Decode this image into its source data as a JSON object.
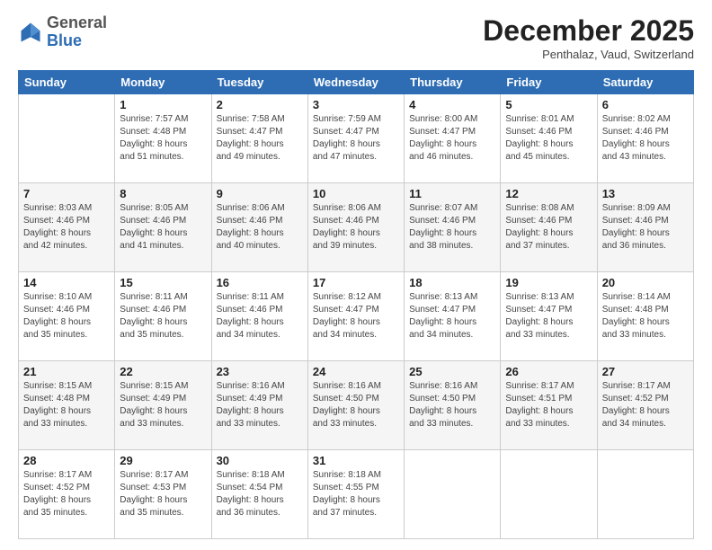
{
  "header": {
    "logo": {
      "general": "General",
      "blue": "Blue"
    },
    "title": "December 2025",
    "subtitle": "Penthalaz, Vaud, Switzerland"
  },
  "weekdays": [
    "Sunday",
    "Monday",
    "Tuesday",
    "Wednesday",
    "Thursday",
    "Friday",
    "Saturday"
  ],
  "weeks": [
    [
      {
        "day": "",
        "info": ""
      },
      {
        "day": "1",
        "info": "Sunrise: 7:57 AM\nSunset: 4:48 PM\nDaylight: 8 hours\nand 51 minutes."
      },
      {
        "day": "2",
        "info": "Sunrise: 7:58 AM\nSunset: 4:47 PM\nDaylight: 8 hours\nand 49 minutes."
      },
      {
        "day": "3",
        "info": "Sunrise: 7:59 AM\nSunset: 4:47 PM\nDaylight: 8 hours\nand 47 minutes."
      },
      {
        "day": "4",
        "info": "Sunrise: 8:00 AM\nSunset: 4:47 PM\nDaylight: 8 hours\nand 46 minutes."
      },
      {
        "day": "5",
        "info": "Sunrise: 8:01 AM\nSunset: 4:46 PM\nDaylight: 8 hours\nand 45 minutes."
      },
      {
        "day": "6",
        "info": "Sunrise: 8:02 AM\nSunset: 4:46 PM\nDaylight: 8 hours\nand 43 minutes."
      }
    ],
    [
      {
        "day": "7",
        "info": "Sunrise: 8:03 AM\nSunset: 4:46 PM\nDaylight: 8 hours\nand 42 minutes."
      },
      {
        "day": "8",
        "info": "Sunrise: 8:05 AM\nSunset: 4:46 PM\nDaylight: 8 hours\nand 41 minutes."
      },
      {
        "day": "9",
        "info": "Sunrise: 8:06 AM\nSunset: 4:46 PM\nDaylight: 8 hours\nand 40 minutes."
      },
      {
        "day": "10",
        "info": "Sunrise: 8:06 AM\nSunset: 4:46 PM\nDaylight: 8 hours\nand 39 minutes."
      },
      {
        "day": "11",
        "info": "Sunrise: 8:07 AM\nSunset: 4:46 PM\nDaylight: 8 hours\nand 38 minutes."
      },
      {
        "day": "12",
        "info": "Sunrise: 8:08 AM\nSunset: 4:46 PM\nDaylight: 8 hours\nand 37 minutes."
      },
      {
        "day": "13",
        "info": "Sunrise: 8:09 AM\nSunset: 4:46 PM\nDaylight: 8 hours\nand 36 minutes."
      }
    ],
    [
      {
        "day": "14",
        "info": "Sunrise: 8:10 AM\nSunset: 4:46 PM\nDaylight: 8 hours\nand 35 minutes."
      },
      {
        "day": "15",
        "info": "Sunrise: 8:11 AM\nSunset: 4:46 PM\nDaylight: 8 hours\nand 35 minutes."
      },
      {
        "day": "16",
        "info": "Sunrise: 8:11 AM\nSunset: 4:46 PM\nDaylight: 8 hours\nand 34 minutes."
      },
      {
        "day": "17",
        "info": "Sunrise: 8:12 AM\nSunset: 4:47 PM\nDaylight: 8 hours\nand 34 minutes."
      },
      {
        "day": "18",
        "info": "Sunrise: 8:13 AM\nSunset: 4:47 PM\nDaylight: 8 hours\nand 34 minutes."
      },
      {
        "day": "19",
        "info": "Sunrise: 8:13 AM\nSunset: 4:47 PM\nDaylight: 8 hours\nand 33 minutes."
      },
      {
        "day": "20",
        "info": "Sunrise: 8:14 AM\nSunset: 4:48 PM\nDaylight: 8 hours\nand 33 minutes."
      }
    ],
    [
      {
        "day": "21",
        "info": "Sunrise: 8:15 AM\nSunset: 4:48 PM\nDaylight: 8 hours\nand 33 minutes."
      },
      {
        "day": "22",
        "info": "Sunrise: 8:15 AM\nSunset: 4:49 PM\nDaylight: 8 hours\nand 33 minutes."
      },
      {
        "day": "23",
        "info": "Sunrise: 8:16 AM\nSunset: 4:49 PM\nDaylight: 8 hours\nand 33 minutes."
      },
      {
        "day": "24",
        "info": "Sunrise: 8:16 AM\nSunset: 4:50 PM\nDaylight: 8 hours\nand 33 minutes."
      },
      {
        "day": "25",
        "info": "Sunrise: 8:16 AM\nSunset: 4:50 PM\nDaylight: 8 hours\nand 33 minutes."
      },
      {
        "day": "26",
        "info": "Sunrise: 8:17 AM\nSunset: 4:51 PM\nDaylight: 8 hours\nand 33 minutes."
      },
      {
        "day": "27",
        "info": "Sunrise: 8:17 AM\nSunset: 4:52 PM\nDaylight: 8 hours\nand 34 minutes."
      }
    ],
    [
      {
        "day": "28",
        "info": "Sunrise: 8:17 AM\nSunset: 4:52 PM\nDaylight: 8 hours\nand 35 minutes."
      },
      {
        "day": "29",
        "info": "Sunrise: 8:17 AM\nSunset: 4:53 PM\nDaylight: 8 hours\nand 35 minutes."
      },
      {
        "day": "30",
        "info": "Sunrise: 8:18 AM\nSunset: 4:54 PM\nDaylight: 8 hours\nand 36 minutes."
      },
      {
        "day": "31",
        "info": "Sunrise: 8:18 AM\nSunset: 4:55 PM\nDaylight: 8 hours\nand 37 minutes."
      },
      {
        "day": "",
        "info": ""
      },
      {
        "day": "",
        "info": ""
      },
      {
        "day": "",
        "info": ""
      }
    ]
  ]
}
